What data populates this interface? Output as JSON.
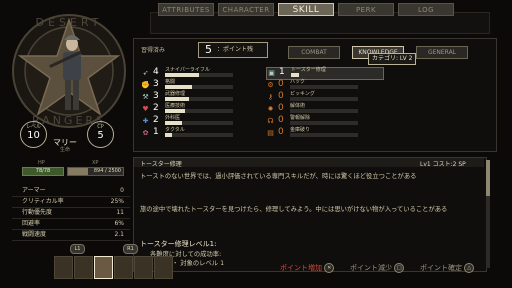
{
  "tabs": [
    "ATTRIBUTES",
    "CHARACTER",
    "SKILL",
    "PERK",
    "LOG"
  ],
  "emblem": {
    "top_text": "DESERT",
    "bottom_text": "RANGERS"
  },
  "character": {
    "left_circle_label": "レベル",
    "left_circle_value": "10",
    "right_circle_label": "CP",
    "right_circle_value": "5",
    "name": "マリー",
    "subtitle": "生命",
    "hp_label": "HP",
    "hp_value": "78/78",
    "xp_label": "XP",
    "xp_value": "894 / 2500",
    "xp_fraction": 0.36
  },
  "attributes": [
    {
      "label": "アーマー",
      "value": "0"
    },
    {
      "label": "クリティカル率",
      "value": "25%"
    },
    {
      "label": "行動優先度",
      "value": "11"
    },
    {
      "label": "回避率",
      "value": "6%"
    },
    {
      "label": "戦闘速度",
      "value": "2.1"
    }
  ],
  "skills_header": {
    "available_label": "習得済み",
    "points_value": "5",
    "points_label": "：ポイント残",
    "buttons": [
      "COMBAT",
      "KNOWLEDGE",
      "GENERAL"
    ],
    "tooltip": "カテゴリ: LV 2"
  },
  "skills_left": [
    {
      "icon": "rifle-icon",
      "level": "4",
      "name": "スナイパーライフル",
      "progress": 0.5
    },
    {
      "icon": "fist-icon",
      "level": "3",
      "name": "格闘",
      "progress": 0.4
    },
    {
      "icon": "weapon-icon",
      "level": "3",
      "name": "武器修理",
      "progress": 0.35
    },
    {
      "icon": "heart-icon",
      "level": "2",
      "name": "医療技術",
      "progress": 0.3
    },
    {
      "icon": "medkit-icon",
      "level": "2",
      "name": "外科医",
      "progress": 0.25
    },
    {
      "icon": "brain-icon",
      "level": "1",
      "name": "タクタル",
      "progress": 0.1
    }
  ],
  "skills_right": [
    {
      "icon": "toaster-icon",
      "level": "1",
      "name": "トースター修理",
      "progress": 0.12
    },
    {
      "icon": "hacking-icon",
      "level": "0",
      "name": "ハック",
      "progress": 0.0
    },
    {
      "icon": "lockpick-icon",
      "level": "0",
      "name": "ピッキング",
      "progress": 0.0
    },
    {
      "icon": "demolition-icon",
      "level": "0",
      "name": "解体術",
      "progress": 0.0
    },
    {
      "icon": "alarm-icon",
      "level": "0",
      "name": "警報解除",
      "progress": 0.0
    },
    {
      "icon": "safe-icon",
      "level": "0",
      "name": "金庫破り",
      "progress": 0.0
    }
  ],
  "description": {
    "title": "トースター修理",
    "cost": "Lv1 コスト:2 SP",
    "line1": "トーストのない世界では、過小評価されている専門スキルだが、時には驚くほど役立つことがある",
    "line2": "旅の途中で壊れたトースターを見つけたら、修理してみよう。中には思いがけない物が入っていることがある",
    "level_label": "トースター修理レベル1:",
    "effect1": "各難度に対しての成功率:",
    "effect2": "60%  ・ 対象のレベル 1"
  },
  "party": {
    "left_button": "L1",
    "right_button": "R1",
    "count": 6,
    "selected": 2
  },
  "prompts": [
    {
      "glyph": "✕",
      "label": "ポイント増加"
    },
    {
      "glyph": "□",
      "label": "ポイント減少"
    },
    {
      "glyph": "△",
      "label": "ポイント確定"
    }
  ],
  "colors": {
    "background": "#0b0a08",
    "accent": "#cfc6ad",
    "hp": "#3e5a2a"
  }
}
